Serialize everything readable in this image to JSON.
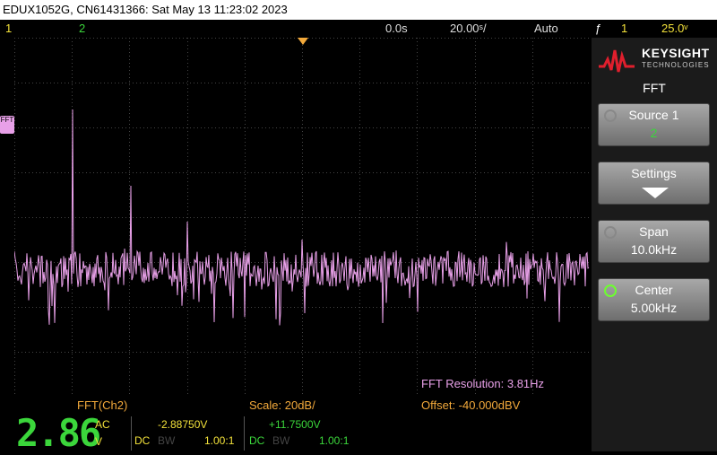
{
  "title_bar": {
    "text": "EDUX1052G, CN61431366: Sat May 13 11:23:02 2023"
  },
  "status_bar": {
    "channel1": "1",
    "channel2": "2",
    "delay": "0.0s",
    "timebase": "20.00ˢ/",
    "trigger_mode": "Auto",
    "trigger_icon": "ƒ",
    "trigger_source": "1",
    "trigger_level": "25.0ᵛ"
  },
  "waveform": {
    "marker_label": "FFT",
    "resolution": "FFT Resolution: 3.81Hz"
  },
  "bottom_info": {
    "source": "FFT(Ch2)",
    "scale": "Scale: 20dB/",
    "offset": "Offset: -40.000dBV"
  },
  "channel_info": {
    "big_value": "2.86",
    "coupling_top": "AC",
    "unit": "V",
    "ch1_value": "-2.88750V",
    "ch2_value": "+11.7500V",
    "ch1_coupling": "DC",
    "ch1_bw": "BW",
    "ch1_probe": "1.00:1",
    "ch2_coupling": "DC",
    "ch2_bw": "BW",
    "ch2_probe": "1.00:1"
  },
  "sidebar": {
    "brand": "KEYSIGHT",
    "brand_sub": "TECHNOLOGIES",
    "menu_title": "FFT",
    "softkeys": [
      {
        "label": "Source 1",
        "value": "2"
      },
      {
        "label": "Settings",
        "value": ""
      },
      {
        "label": "Span",
        "value": "10.0kHz"
      },
      {
        "label": "Center",
        "value": "5.00kHz"
      }
    ]
  },
  "colors": {
    "fft_trace": "#e8a0e8",
    "ch1": "#f2e13a",
    "ch2": "#3bd63b",
    "accent": "#f2a93b"
  },
  "icons": [
    "keysight-logo-icon",
    "trigger-edge-icon",
    "trigger-marker-icon",
    "settings-arrow-icon",
    "knob-icon"
  ]
}
